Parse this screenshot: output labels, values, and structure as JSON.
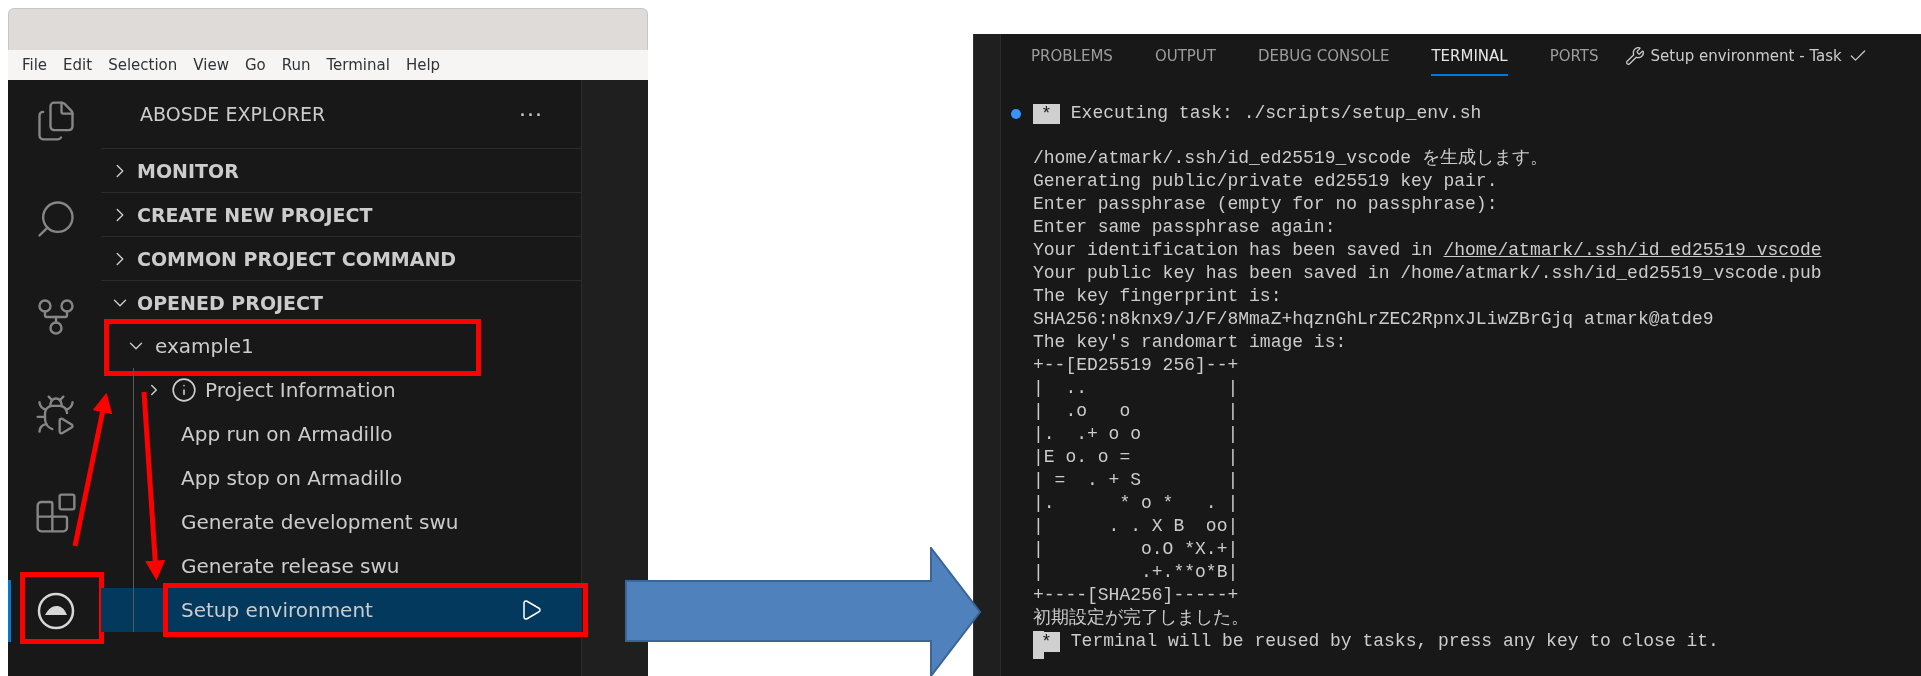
{
  "left_window": {
    "menu": [
      "File",
      "Edit",
      "Selection",
      "View",
      "Go",
      "Run",
      "Terminal",
      "Help"
    ],
    "activity_bar": [
      {
        "kind": "files",
        "selected": false
      },
      {
        "kind": "search",
        "selected": false
      },
      {
        "kind": "source-control",
        "selected": false
      },
      {
        "kind": "debug",
        "selected": false
      },
      {
        "kind": "extensions",
        "selected": false
      },
      {
        "kind": "abos",
        "selected": true
      }
    ],
    "sidebar": {
      "title": "ABOSDE EXPLORER",
      "more": "···",
      "sections": [
        {
          "label": "MONITOR",
          "expanded": false
        },
        {
          "label": "CREATE NEW PROJECT",
          "expanded": false
        },
        {
          "label": "COMMON PROJECT COMMAND",
          "expanded": false
        },
        {
          "label": "OPENED PROJECT",
          "expanded": true,
          "children": [
            {
              "label": "example1",
              "expanded": true,
              "children": [
                {
                  "label": "Project Information",
                  "kind": "info",
                  "expanded": false,
                  "selected": false
                },
                {
                  "label": "App run on Armadillo",
                  "kind": "command",
                  "selected": false
                },
                {
                  "label": "App stop on Armadillo",
                  "kind": "command",
                  "selected": false
                },
                {
                  "label": "Generate development swu",
                  "kind": "command",
                  "selected": false
                },
                {
                  "label": "Generate release swu",
                  "kind": "command",
                  "selected": false
                },
                {
                  "label": "Setup environment",
                  "kind": "command",
                  "selected": true
                }
              ]
            }
          ]
        }
      ]
    }
  },
  "terminal_panel": {
    "tabs": [
      {
        "label": "PROBLEMS",
        "selected": false
      },
      {
        "label": "OUTPUT",
        "selected": false
      },
      {
        "label": "DEBUG CONSOLE",
        "selected": false
      },
      {
        "label": "TERMINAL",
        "selected": true
      },
      {
        "label": "PORTS",
        "selected": false
      }
    ],
    "task": {
      "label": "Setup environment - Task",
      "done": true
    },
    "lines": [
      {
        "kind": "task",
        "marker": "*",
        "text": "Executing task: ./scripts/setup_env.sh",
        "dot": true
      },
      {
        "kind": "text",
        "text": "/home/atmark/.ssh/id_ed25519_vscode を生成します。"
      },
      {
        "kind": "text",
        "text": "Generating public/private ed25519 key pair."
      },
      {
        "kind": "text",
        "text": "Enter passphrase (empty for no passphrase):"
      },
      {
        "kind": "text",
        "text": "Enter same passphrase again:"
      },
      {
        "kind": "link",
        "text": "Your identification has been saved in ",
        "link": "/home/atmark/.ssh/id_ed25519_vscode"
      },
      {
        "kind": "text",
        "text": "Your public key has been saved in /home/atmark/.ssh/id_ed25519_vscode.pub"
      },
      {
        "kind": "text",
        "text": "The key fingerprint is:"
      },
      {
        "kind": "text",
        "text": "SHA256:n8knx9/J/F/8MmaZ+hqznGhLrZEC2RpnxJLiwZBrGjq atmark@atde9"
      },
      {
        "kind": "text",
        "text": "The key's randomart image is:"
      },
      {
        "kind": "text",
        "text": "+--[ED25519 256]--+"
      },
      {
        "kind": "text",
        "text": "|  ..             |"
      },
      {
        "kind": "text",
        "text": "|  .o   o         |"
      },
      {
        "kind": "text",
        "text": "|.  .+ o o        |"
      },
      {
        "kind": "text",
        "text": "|E o. o =         |"
      },
      {
        "kind": "text",
        "text": "| =  . + S        |"
      },
      {
        "kind": "text",
        "text": "|.      * o *   . |"
      },
      {
        "kind": "text",
        "text": "|      . . X B  oo|"
      },
      {
        "kind": "text",
        "text": "|         o.O *X.+|"
      },
      {
        "kind": "text",
        "text": "|         .+.**o*B|"
      },
      {
        "kind": "text",
        "text": "+----[SHA256]-----+"
      },
      {
        "kind": "text",
        "text": "初期設定が完了しました。"
      },
      {
        "kind": "task",
        "marker": "*",
        "text": "Terminal will be reused by tasks, press any key to close it.",
        "dot": false
      }
    ]
  }
}
